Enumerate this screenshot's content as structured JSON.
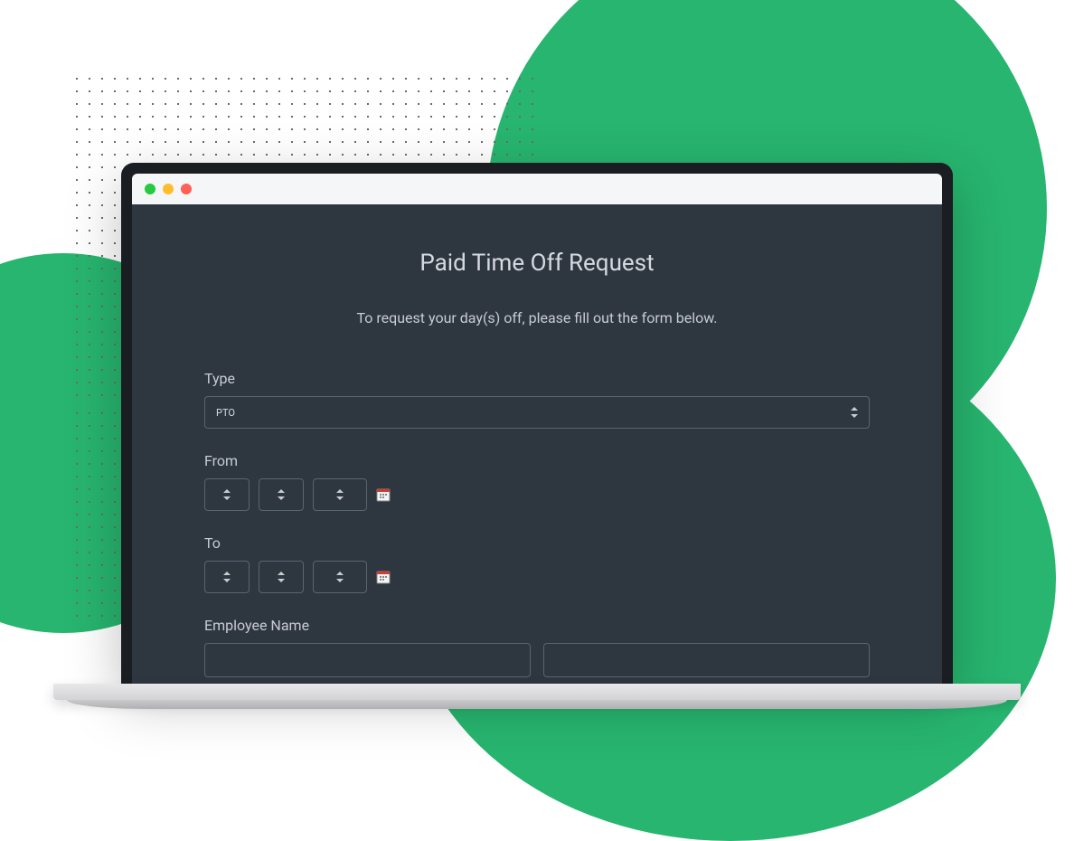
{
  "form": {
    "title": "Paid Time Off Request",
    "subtitle": "To request your day(s) off, please fill out the form below.",
    "type": {
      "label": "Type",
      "selected": "PTO"
    },
    "from": {
      "label": "From"
    },
    "to": {
      "label": "To"
    },
    "employeeName": {
      "label": "Employee Name"
    }
  }
}
